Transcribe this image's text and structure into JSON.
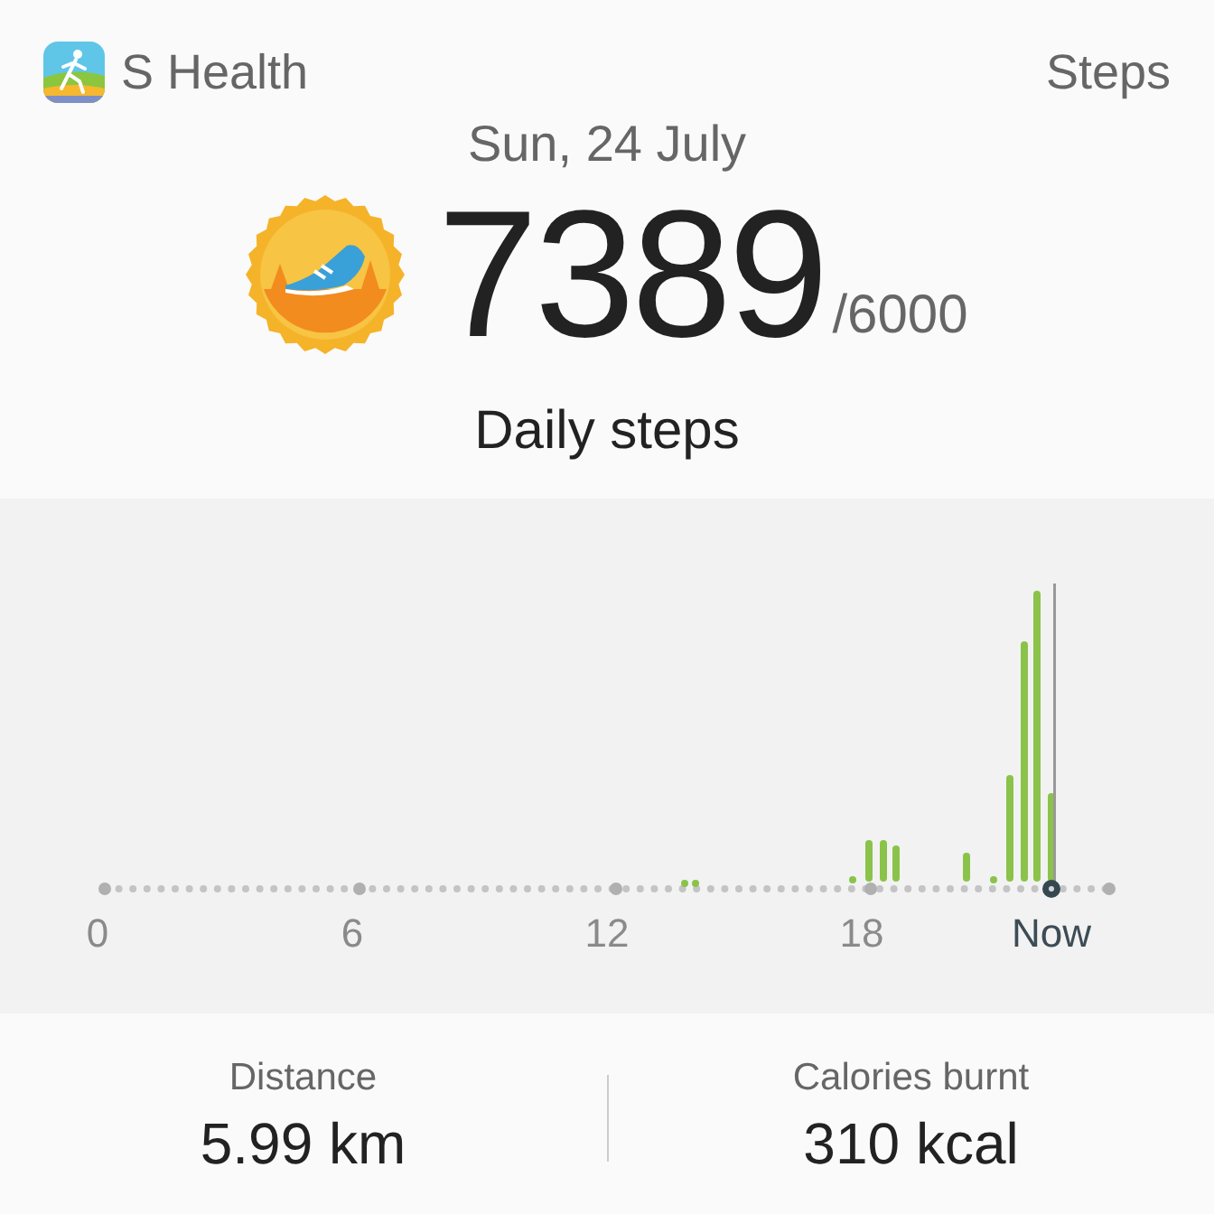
{
  "header": {
    "app_name": "S Health",
    "section": "Steps"
  },
  "date": "Sun, 24 July",
  "summary": {
    "steps": "7389",
    "goal": "/6000",
    "label": "Daily steps"
  },
  "chart": {
    "x_labels": [
      {
        "label": "0",
        "current": false
      },
      {
        "label": "6",
        "current": false
      },
      {
        "label": "12",
        "current": false
      },
      {
        "label": "18",
        "current": false
      },
      {
        "label": "Now",
        "current": true
      }
    ]
  },
  "stats": [
    {
      "label": "Distance",
      "value": "5.99 km"
    },
    {
      "label": "Calories burnt",
      "value": "310 kcal"
    }
  ]
}
